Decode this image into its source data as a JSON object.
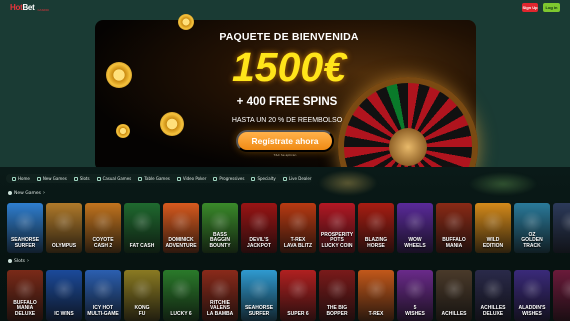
{
  "header": {
    "logo_text_a": "Hot",
    "logo_text_b": "Bet",
    "logo_sub": "CASINO",
    "signup_label": "Sign Up",
    "login_label": "Log in"
  },
  "hero": {
    "title": "PAQUETE DE BIENVENIDA",
    "amount": "1500€",
    "spins": "+ 400 FREE SPINS",
    "refund": "HASTA UN 20 % DE REEMBOLSO",
    "cta": "Regístrate ahora",
    "terms": "T&C Se aplican"
  },
  "nav": {
    "items": [
      "Home",
      "New Games",
      "Slots",
      "Casual Games",
      "Table Games",
      "Video Poker",
      "Progressives",
      "Specialty",
      "Live Dealer"
    ]
  },
  "sections": {
    "new_games": "New Games",
    "slots": "Slots"
  },
  "new_games": [
    {
      "name": "SEAHORSE\nSURFER",
      "bg": "#2f7fd0"
    },
    {
      "name": "OLYMPUS",
      "bg": "#b07a2a"
    },
    {
      "name": "COYOTE\nCASH 2",
      "bg": "#c2741e"
    },
    {
      "name": "FAT CASH",
      "bg": "#1f6a2f"
    },
    {
      "name": "DOMINICK\nADVENTURE",
      "bg": "#d85a1e"
    },
    {
      "name": "BASS\nBAGGIN\nBOUNTY",
      "bg": "#3a8a2a"
    },
    {
      "name": "DEVIL'S\nJACKPOT",
      "bg": "#9a1414"
    },
    {
      "name": "T-REX\nLAVA BLITZ",
      "bg": "#b83a12"
    },
    {
      "name": "PROSPERITY\nPOTS\nLUCKY COIN",
      "bg": "#b31824"
    },
    {
      "name": "BLAZING\nHORSE",
      "bg": "#a81d12"
    },
    {
      "name": "WOW\nWHEELS",
      "bg": "#5a2a9a"
    },
    {
      "name": "BUFFALO\nMANIA",
      "bg": "#8a2a16"
    },
    {
      "name": "WILD\nEDITION",
      "bg": "#d48a1a"
    },
    {
      "name": "OZ\nGOLDEN\nTRACK",
      "bg": "#2a7a9a"
    },
    {
      "name": "",
      "bg": "#2c3a5a"
    }
  ],
  "slots": [
    {
      "name": "BUFFALO\nMANIA\nDELUXE",
      "bg": "#7a2a18"
    },
    {
      "name": "IC WINS",
      "bg": "#1b4a9a"
    },
    {
      "name": "ICY HOT\nMULTI-GAME",
      "bg": "#2b5fb0"
    },
    {
      "name": "KONG\nFU",
      "bg": "#8a7a22"
    },
    {
      "name": "LUCKY 6",
      "bg": "#2a7a2a"
    },
    {
      "name": "RITCHIE\nVALENS\nLA BAMBA",
      "bg": "#8a2a1a"
    },
    {
      "name": "SEAHORSE\nSURFER",
      "bg": "#2f9ad0"
    },
    {
      "name": "SUPER 6",
      "bg": "#b02020"
    },
    {
      "name": "THE BIG\nBOPPER",
      "bg": "#7a1a1a"
    },
    {
      "name": "T-REX",
      "bg": "#c2581a"
    },
    {
      "name": "5\nWISHES",
      "bg": "#6a2a8a"
    },
    {
      "name": "ACHILLES",
      "bg": "#4a3a2a"
    },
    {
      "name": "ACHILLES\nDELUXE",
      "bg": "#2a2a4a"
    },
    {
      "name": "ALADDIN'S\nWISHES",
      "bg": "#3a2a7a"
    },
    {
      "name": "",
      "bg": "#6a1a3a"
    }
  ],
  "colors": {
    "page_bg": "#1a3b34",
    "accent_yellow": "#ffe51a",
    "signup_red": "#e0262e",
    "login_green": "#7ec82f",
    "cta_orange": "#f5a131"
  }
}
